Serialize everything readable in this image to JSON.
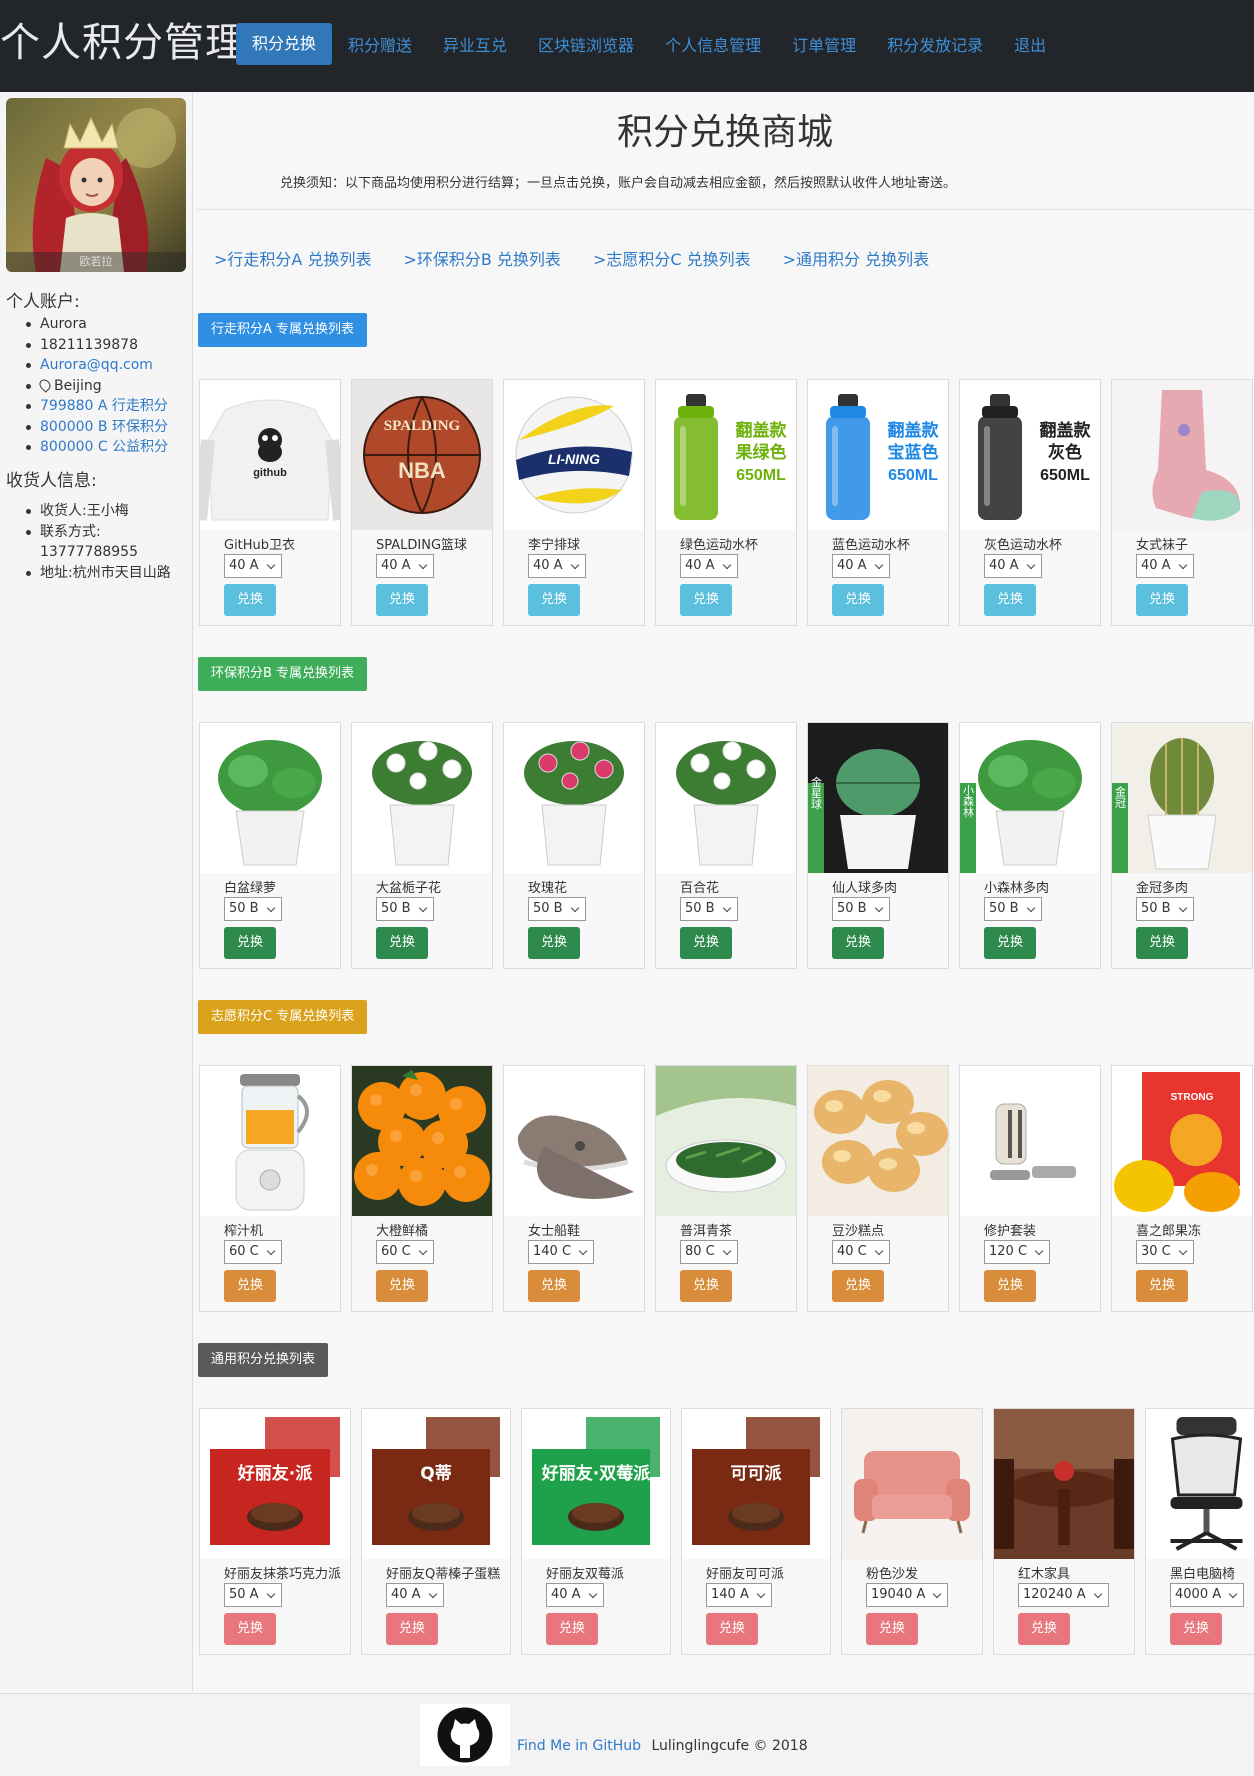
{
  "brand": "个人积分管理",
  "nav": [
    "积分兑换",
    "积分赠送",
    "异业互兑",
    "区块链浏览器",
    "个人信息管理",
    "订单管理",
    "积分发放记录",
    "退出"
  ],
  "sidebar": {
    "avatar_caption": "歐若拉",
    "account_title": "个人账户:",
    "account": [
      "Aurora",
      "18211139878",
      "Aurora@qq.com",
      "Beijing",
      "799880 A 行走积分",
      "800000 B 环保积分",
      "800000 C 公益积分"
    ],
    "shipping_title": "收货人信息:",
    "shipping": [
      "收货人:王小梅",
      "联系方式:",
      "13777788955",
      "地址:杭州市天目山路"
    ]
  },
  "main": {
    "title": "积分兑换商城",
    "notice": "兑换须知：以下商品均使用积分进行结算；一旦点击兑换，账户会自动减去相应金额，然后按照默认收件人地址寄送。",
    "anchors": [
      ">行走积分A 兑换列表",
      ">环保积分B 兑换列表",
      ">志愿积分C 兑换列表",
      ">通用积分 兑换列表"
    ]
  },
  "buy_label": "兑换",
  "sections": [
    {
      "title": "行走积分A 专属兑换列表",
      "color": "#2f8fe3",
      "button_color": "#5bc0de",
      "products": [
        {
          "name": "GitHub卫衣",
          "price": "40 A",
          "icon": "github-hoodie"
        },
        {
          "name": "SPALDING篮球",
          "price": "40 A",
          "icon": "basketball"
        },
        {
          "name": "李宁排球",
          "price": "40 A",
          "icon": "volleyball"
        },
        {
          "name": "绿色运动水杯",
          "price": "40 A",
          "icon": "water-bottle",
          "tagline": [
            "翻盖款",
            "果绿色",
            "650ML"
          ],
          "tag_color": "#6fb10b"
        },
        {
          "name": "蓝色运动水杯",
          "price": "40 A",
          "icon": "water-bottle",
          "tagline": [
            "翻盖款",
            "宝蓝色",
            "650ML"
          ],
          "tag_color": "#1e88e5"
        },
        {
          "name": "灰色运动水杯",
          "price": "40 A",
          "icon": "water-bottle",
          "tagline": [
            "翻盖款",
            "灰色",
            "650ML"
          ],
          "tag_color": "#222222"
        },
        {
          "name": "女式袜子",
          "price": "40 A",
          "icon": "sock"
        }
      ]
    },
    {
      "title": "环保积分B 专属兑换列表",
      "color": "#3fae5a",
      "button_color": "#2f8a4e",
      "products": [
        {
          "name": "白盆绿萝",
          "price": "50 B",
          "icon": "potted-plant"
        },
        {
          "name": "大盆栀子花",
          "price": "50 B",
          "icon": "flower-pot"
        },
        {
          "name": "玫瑰花",
          "price": "50 B",
          "icon": "flower-pot"
        },
        {
          "name": "百合花",
          "price": "50 B",
          "icon": "flower-pot"
        },
        {
          "name": "仙人球多肉",
          "price": "50 B",
          "icon": "succulent",
          "tagline": [
            "金星球",
            "白色盆"
          ]
        },
        {
          "name": "小森林多肉",
          "price": "50 B",
          "icon": "potted-plant",
          "tagline": [
            "小森林",
            "白色盆"
          ]
        },
        {
          "name": "金冠多肉",
          "price": "50 B",
          "icon": "cactus",
          "tagline": [
            "金冠",
            "白色盆"
          ]
        }
      ]
    },
    {
      "title": "志愿积分C 专属兑换列表",
      "color": "#d9a21a",
      "button_color": "#d98c3a",
      "products": [
        {
          "name": "榨汁机",
          "price": "60 C",
          "icon": "juicer"
        },
        {
          "name": "大橙鲜橘",
          "price": "60 C",
          "icon": "oranges"
        },
        {
          "name": "女士船鞋",
          "price": "140 C",
          "icon": "shoes"
        },
        {
          "name": "普洱青茶",
          "price": "80 C",
          "icon": "tea"
        },
        {
          "name": "豆沙糕点",
          "price": "40 C",
          "icon": "pastry"
        },
        {
          "name": "修护套装",
          "price": "120 C",
          "icon": "repair-kit"
        },
        {
          "name": "喜之郎果冻",
          "price": "30 C",
          "icon": "jelly",
          "tagline": [
            "STRONG"
          ]
        }
      ]
    },
    {
      "title": "通用积分兑换列表",
      "color": "#5a5a5a",
      "button_color": "#e8777d",
      "products": [
        {
          "name": "好丽友抹茶巧克力派",
          "price": "50 A",
          "icon": "snack-box",
          "tagline": [
            "好丽友·派"
          ]
        },
        {
          "name": "好丽友Q蒂榛子蛋糕",
          "price": "40 A",
          "icon": "snack-box",
          "tagline": [
            "Q蒂"
          ]
        },
        {
          "name": "好丽友双莓派",
          "price": "40 A",
          "icon": "snack-box",
          "tagline": [
            "好丽友·双莓派"
          ]
        },
        {
          "name": "好丽友可可派",
          "price": "140 A",
          "icon": "snack-box",
          "tagline": [
            "可可派"
          ]
        },
        {
          "name": "粉色沙发",
          "price": "19040 A",
          "icon": "sofa"
        },
        {
          "name": "红木家具",
          "price": "120240 A",
          "icon": "dining-set"
        },
        {
          "name": "黑白电脑椅",
          "price": "4000 A",
          "icon": "office-chair"
        }
      ]
    }
  ],
  "footer": {
    "link": "Find Me in GitHub",
    "credit": "Lulinglingcufe © 2018"
  },
  "colors": {
    "header_bg": "#22262b",
    "nav_active": "#3278b8",
    "link": "#2f7ac8"
  }
}
